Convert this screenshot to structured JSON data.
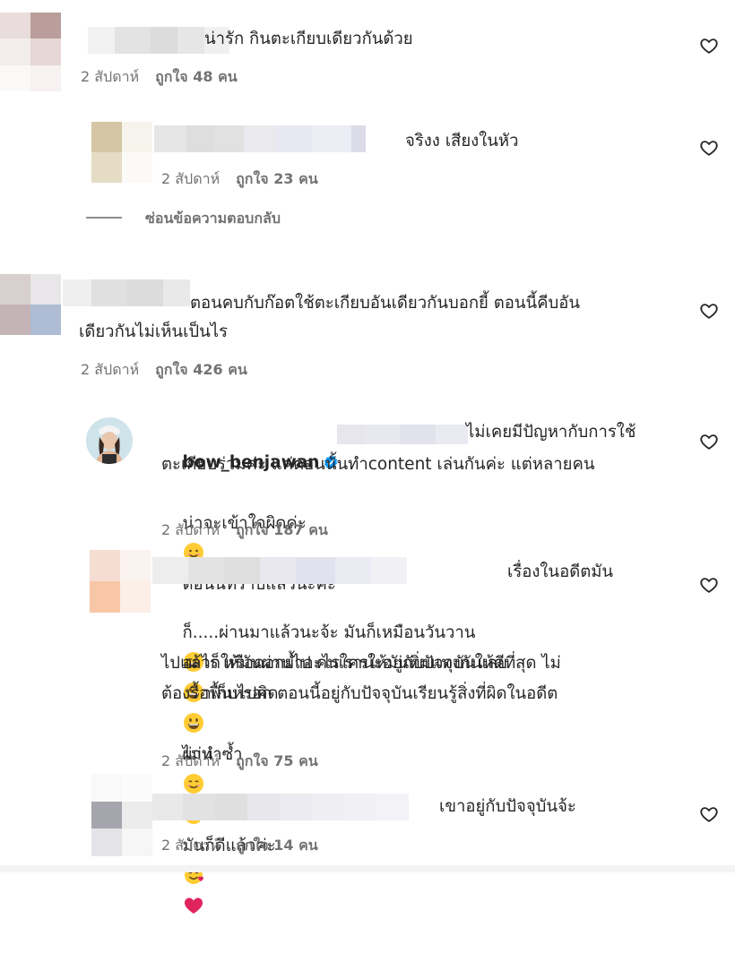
{
  "comments": [
    {
      "text": "น่ารัก กินตะเกียบเดียวกันด้วย",
      "time": "2 สัปดาห์",
      "likes": "ถูกใจ 48 คน"
    },
    {
      "text": "จริงง เสียงในหัว",
      "time": "2 สัปดาห์",
      "likes": "ถูกใจ 23 คน",
      "hide_replies": "ซ่อนข้อความตอบกลับ"
    },
    {
      "text_line1": "ตอนคบกับก๊อตใช้ตะเกียบอันเดียวกันบอกยี้ ตอนนี้คีบอัน",
      "text_line2": "เดียวกันไม่เห็นเป็นไร",
      "time": "2 สัปดาห์",
      "likes": "ถูกใจ 426 คน"
    },
    {
      "username": "bow_benjawan",
      "text_line1": "ไม่เคยมีปัญหากับการใช้",
      "text_line2": "ตะเกียบร่วมค่ะ แค่ตอนนั้นทำcontent เล่นกันค่ะ แต่หลายคน",
      "text_line3": "น่าจะเข้าใจผิดค่ะ",
      "text_line3b": "ตอนนี้ทราบแล้วนะคะ",
      "time": "2 สัปดาห์",
      "likes": "ถูกใจ 187 คน"
    },
    {
      "text_line1": "เรื่องในอดีตมัน",
      "text_line2": "ก็.....ผ่านมาแล้วนะจ้ะ มันก็เหมือนวันวาน",
      "text_line2b": "อย่าเก็บไปคิด",
      "text_line3": "อะไร หรือดอกย้ำอะไรใครให้มันทิ่มแทงกันเลย",
      "text_line3b": "ผ่าน",
      "text_line4": "ไปแล้วก็ให้มันผ่านไป คนเราน่ะอยู่กับปัจจุบันให้ดีที่สุด ไม่",
      "text_line5": "ต้องรื้อฟื้นหรอก ตอนนี้อยู่กับปัจจุบันเรียนรู้สิ่งที่ผิดในอดีต",
      "text_line6": "ไม่ทำซ้ำ",
      "text_line6b": "มันก็ดีแล้วค่ะ",
      "time": "2 สัปดาห์",
      "likes": "ถูกใจ 75 คน"
    },
    {
      "text": "เขาอยู่กับปัจจุบันจ้ะ",
      "time": "2 สัปดาห์",
      "likes": "ถูกใจ 14 คน"
    }
  ],
  "icons": {
    "like": "heart-outline-icon",
    "verified": "verified-badge-icon",
    "emoji_smile": "smiling-face-icon",
    "emoji_grin": "grinning-face-icon",
    "emoji_halo": "halo-face-icon",
    "emoji_hearts": "smiling-face-with-hearts-icon",
    "emoji_heart": "red-heart-icon"
  },
  "colors": {
    "text": "#262626",
    "meta": "#737373",
    "verified": "#0095f6",
    "heart_red": "#e0245e"
  }
}
